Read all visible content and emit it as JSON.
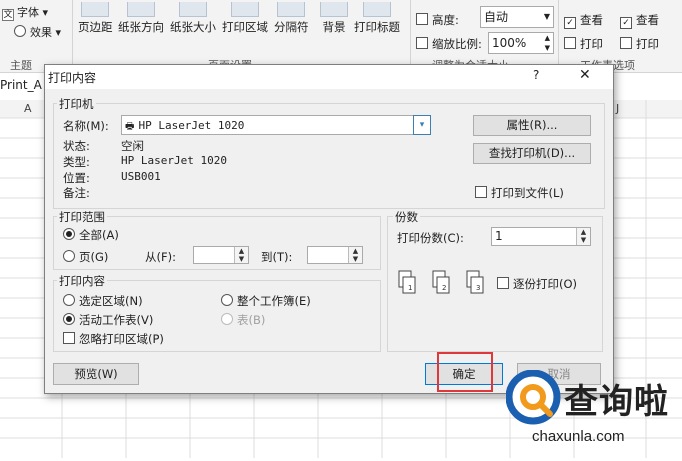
{
  "ribbon": {
    "font_label": "字体",
    "effects_label": "效果",
    "theme_group": "主题",
    "page_setup_buttons": [
      "页边距",
      "纸张方向",
      "纸张大小",
      "打印区域",
      "分隔符",
      "背景",
      "打印标题"
    ],
    "page_setup_group": "页面设置",
    "scale_group": "调整为合适大小",
    "height_label": "高度:",
    "height_value": "自动",
    "scale_label": "缩放比例:",
    "scale_value": "100%",
    "view_label_1": "查看",
    "print_label_1": "打印",
    "view_label_2": "查看",
    "print_label_2": "打印",
    "sheet_options_group": "工作表选项"
  },
  "name_box": "Print_A",
  "columns": [
    "A",
    "J"
  ],
  "dialog": {
    "title": "打印内容",
    "help": "?",
    "close": "✕",
    "printer": {
      "group_label": "打印机",
      "name_label": "名称(M):",
      "name_value": "HP LaserJet 1020",
      "status_label": "状态:",
      "status_value": "空闲",
      "type_label": "类型:",
      "type_value": "HP LaserJet 1020",
      "where_label": "位置:",
      "where_value": "USB001",
      "comment_label": "备注:",
      "properties_button": "属性(R)...",
      "find_button": "查找打印机(D)...",
      "print_to_file": "打印到文件(L)"
    },
    "range": {
      "group_label": "打印范围",
      "all": "全部(A)",
      "pages": "页(G)",
      "from_label": "从(F):",
      "to_label": "到(T):"
    },
    "copies": {
      "group_label": "份数",
      "count_label": "打印份数(C):",
      "count_value": "1",
      "collate": "逐份打印(O)"
    },
    "what": {
      "group_label": "打印内容",
      "selection": "选定区域(N)",
      "workbook": "整个工作簿(E)",
      "active_sheets": "活动工作表(V)",
      "table": "表(B)",
      "ignore_area": "忽略打印区域(P)"
    },
    "preview_button": "预览(W)",
    "ok_button": "确定",
    "cancel_button": "取消"
  },
  "watermark": {
    "brand": "查询啦",
    "url": "chaxunla.com"
  },
  "colors": {
    "highlight": "#e0373a",
    "brand_blue": "#1a5fb0",
    "brand_orange": "#f29a1b"
  }
}
